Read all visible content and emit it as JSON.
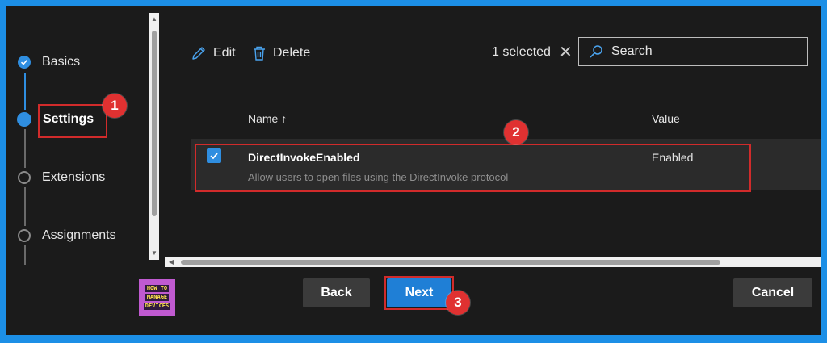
{
  "stepper": {
    "steps": [
      {
        "label": "Basics",
        "state": "completed"
      },
      {
        "label": "Settings",
        "state": "current"
      },
      {
        "label": "Extensions",
        "state": "upcoming"
      },
      {
        "label": "Assignments",
        "state": "upcoming"
      }
    ]
  },
  "toolbar": {
    "edit_label": "Edit",
    "delete_label": "Delete",
    "selected_count": "1 selected",
    "search_placeholder": "Search"
  },
  "table": {
    "columns": [
      "Name ↑",
      "Value"
    ],
    "rows": [
      {
        "checked": true,
        "name": "DirectInvokeEnabled",
        "description": "Allow users to open files using the DirectInvoke protocol",
        "value": "Enabled"
      }
    ]
  },
  "footer": {
    "logo_lines": [
      "HOW TO",
      "MANAGE",
      "DEVICES"
    ],
    "back_label": "Back",
    "next_label": "Next",
    "cancel_label": "Cancel"
  },
  "annotations": {
    "badge_1": "1",
    "badge_2": "2",
    "badge_3": "3"
  },
  "colors": {
    "accent": "#1f7fd6",
    "annotation_red": "#e03131",
    "background": "#1b1b1b",
    "frame": "#1c8fe6"
  }
}
